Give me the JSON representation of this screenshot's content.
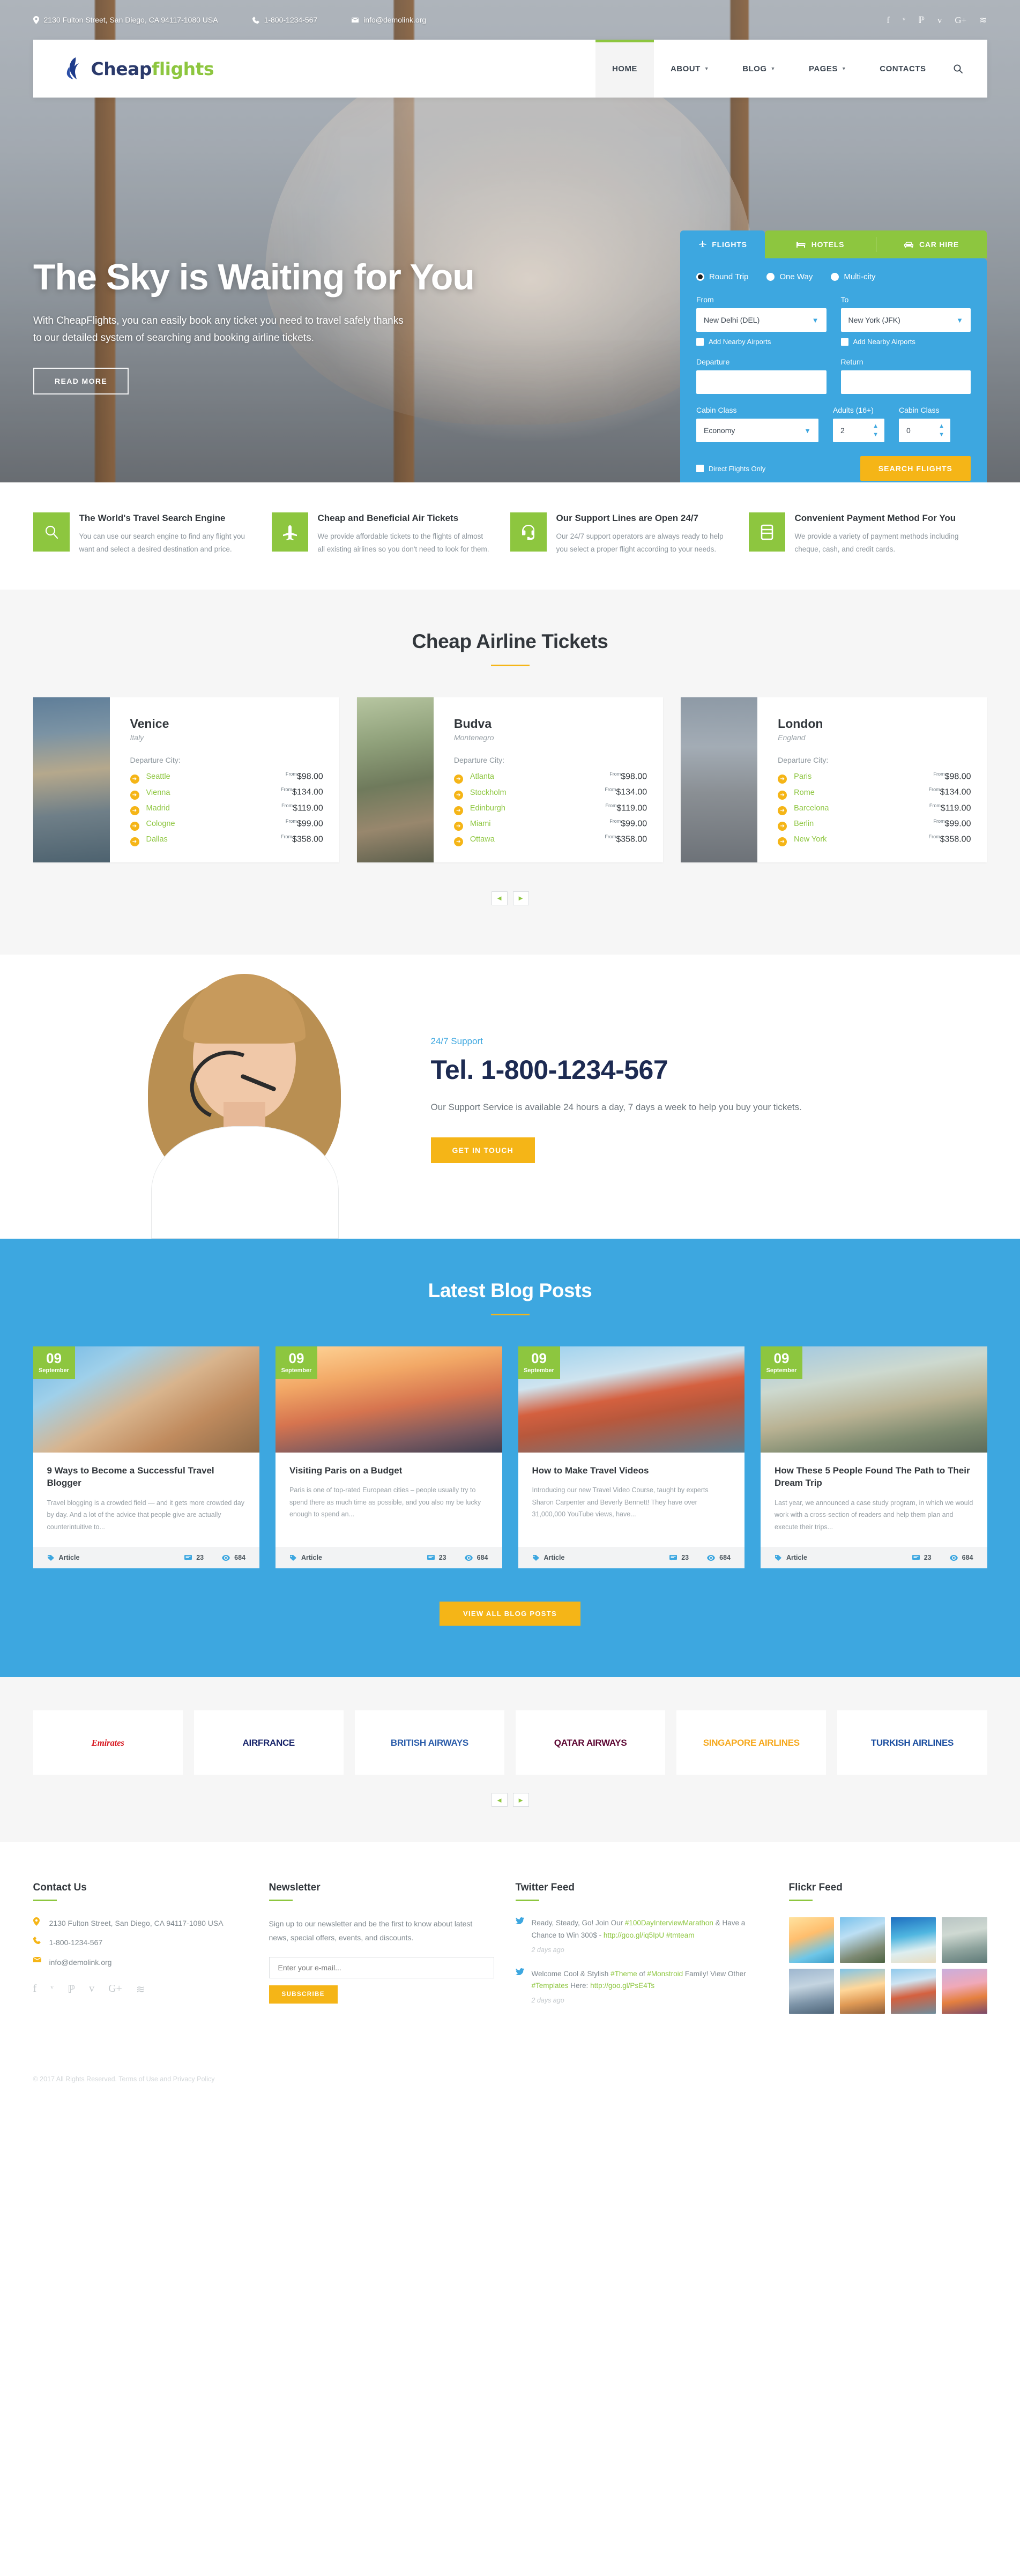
{
  "topbar": {
    "address": "2130 Fulton Street, San Diego, CA 94117-1080 USA",
    "phone": "1-800-1234-567",
    "email": "info@demolink.org",
    "social": [
      {
        "name": "facebook",
        "glyph": "f"
      },
      {
        "name": "twitter",
        "glyph": "ᵛ"
      },
      {
        "name": "pinterest",
        "glyph": "ℙ"
      },
      {
        "name": "vimeo",
        "glyph": "ᴠ"
      },
      {
        "name": "google-plus",
        "glyph": "G+"
      },
      {
        "name": "rss",
        "glyph": "≋"
      }
    ]
  },
  "header": {
    "logo_primary": "Cheap",
    "logo_accent": "flights",
    "nav": [
      {
        "label": "HOME",
        "has_caret": false,
        "active": true
      },
      {
        "label": "ABOUT",
        "has_caret": true,
        "active": false
      },
      {
        "label": "BLOG",
        "has_caret": true,
        "active": false
      },
      {
        "label": "PAGES",
        "has_caret": true,
        "active": false
      },
      {
        "label": "CONTACTS",
        "has_caret": false,
        "active": false
      }
    ],
    "search_icon": "search-icon"
  },
  "hero": {
    "title": "The Sky is Waiting for You",
    "subtitle": "With CheapFlights, you can easily book any ticket you need to travel safely thanks to our detailed system of searching and booking airline tickets.",
    "button": "READ MORE"
  },
  "booking": {
    "tabs": [
      {
        "label": "FLIGHTS",
        "icon": "plane-icon",
        "active": true
      },
      {
        "label": "HOTELS",
        "icon": "bed-icon",
        "active": false
      },
      {
        "label": "CAR HIRE",
        "icon": "car-icon",
        "active": false
      }
    ],
    "trip_types": [
      {
        "label": "Round Trip",
        "selected": true
      },
      {
        "label": "One Way",
        "selected": false
      },
      {
        "label": "Multi-city",
        "selected": false
      }
    ],
    "from_label": "From",
    "from_value": "New Delhi (DEL)",
    "to_label": "To",
    "to_value": "New York (JFK)",
    "nearby_from": "Add Nearby Airports",
    "nearby_to": "Add Nearby Airports",
    "departure_label": "Departure",
    "departure_value": "",
    "return_label": "Return",
    "return_value": "",
    "cabin_label": "Cabin Class",
    "cabin_value": "Economy",
    "adults_label": "Adults (16+)",
    "adults_value": "2",
    "cabin2_label": "Cabin Class",
    "cabin2_value": "0",
    "direct_only": "Direct Flights Only",
    "search_button": "SEARCH FLIGHTS"
  },
  "features": [
    {
      "icon": "search-icon",
      "title": "The World's Travel Search Engine",
      "text": "You can use our search engine to find any flight you want and select a desired destination and price."
    },
    {
      "icon": "plane-icon",
      "title": "Cheap and Beneficial Air Tickets",
      "text": "We provide affordable tickets to the flights of almost all existing airlines so you don't need to look for them."
    },
    {
      "icon": "headset-icon",
      "title": "Our Support Lines are Open 24/7",
      "text": "Our 24/7 support operators are always ready to help you select a proper flight according to your needs."
    },
    {
      "icon": "card-icon",
      "title": "Convenient Payment Method For You",
      "text": "We provide a variety of payment methods including cheque, cash, and credit cards."
    }
  ],
  "tickets": {
    "title": "Cheap Airline Tickets",
    "departure_label": "Departure City:",
    "from_prefix": "From",
    "prev_icon": "chevron-left-icon",
    "next_icon": "chevron-right-icon",
    "cards": [
      {
        "city": "Venice",
        "country": "Italy",
        "photo": "ph-venice",
        "routes": [
          {
            "city": "Seattle",
            "price": "$98.00"
          },
          {
            "city": "Vienna",
            "price": "$134.00"
          },
          {
            "city": "Madrid",
            "price": "$119.00"
          },
          {
            "city": "Cologne",
            "price": "$99.00"
          },
          {
            "city": "Dallas",
            "price": "$358.00"
          }
        ]
      },
      {
        "city": "Budva",
        "country": "Montenegro",
        "photo": "ph-budva",
        "routes": [
          {
            "city": "Atlanta",
            "price": "$98.00"
          },
          {
            "city": "Stockholm",
            "price": "$134.00"
          },
          {
            "city": "Edinburgh",
            "price": "$119.00"
          },
          {
            "city": "Miami",
            "price": "$99.00"
          },
          {
            "city": "Ottawa",
            "price": "$358.00"
          }
        ]
      },
      {
        "city": "London",
        "country": "England",
        "photo": "ph-london",
        "routes": [
          {
            "city": "Paris",
            "price": "$98.00"
          },
          {
            "city": "Rome",
            "price": "$134.00"
          },
          {
            "city": "Barcelona",
            "price": "$119.00"
          },
          {
            "city": "Berlin",
            "price": "$99.00"
          },
          {
            "city": "New York",
            "price": "$358.00"
          }
        ]
      }
    ]
  },
  "support": {
    "kicker": "24/7 Support",
    "tel": "Tel. 1-800-1234-567",
    "desc": "Our Support Service is available 24 hours a day, 7 days a week to help you buy your tickets.",
    "button": "GET IN TOUCH"
  },
  "blog": {
    "title": "Latest Blog Posts",
    "view_all": "VIEW ALL BLOG POSTS",
    "meta_tag": "Article",
    "posts": [
      {
        "day": "09",
        "month": "September",
        "title": "9 Ways to Become a Successful Travel Blogger",
        "excerpt": "Travel blogging is a crowded field — and it gets more crowded day by day. And a lot of the advice that people give are actually counterintuitive to...",
        "comments": "23",
        "views": "684",
        "photo": "pimg1"
      },
      {
        "day": "09",
        "month": "September",
        "title": "Visiting Paris on a Budget",
        "excerpt": "Paris is one of top-rated European cities – people usually try to spend there as much time as possible, and you also my be lucky enough to spend an...",
        "comments": "23",
        "views": "684",
        "photo": "pimg2"
      },
      {
        "day": "09",
        "month": "September",
        "title": "How to Make Travel Videos",
        "excerpt": "Introducing our new Travel Video Course, taught by experts Sharon Carpenter and Beverly Bennett! They have over 31,000,000 YouTube views, have...",
        "comments": "23",
        "views": "684",
        "photo": "pimg3"
      },
      {
        "day": "09",
        "month": "September",
        "title": "How These 5 People Found The Path to Their Dream Trip",
        "excerpt": "Last year, we announced a case study program, in which we would work with a cross-section of readers and help them plan and execute their trips...",
        "comments": "23",
        "views": "684",
        "photo": "pimg4"
      }
    ]
  },
  "partners": {
    "prev_icon": "chevron-left-icon",
    "next_icon": "chevron-right-icon",
    "logos": [
      {
        "name": "Emirates",
        "color": "#d71921"
      },
      {
        "name": "AIRFRANCE",
        "color": "#18256b"
      },
      {
        "name": "BRITISH AIRWAYS",
        "color": "#2a5caa"
      },
      {
        "name": "QATAR AIRWAYS",
        "color": "#5c0632"
      },
      {
        "name": "SINGAPORE AIRLINES",
        "color": "#f6a81c"
      },
      {
        "name": "TURKISH AIRLINES",
        "color": "#1b4ea0"
      }
    ]
  },
  "footer": {
    "contact": {
      "title": "Contact Us",
      "address": "2130 Fulton Street, San Diego, CA 94117-1080 USA",
      "phone": "1-800-1234-567",
      "email": "info@demolink.org",
      "social": [
        {
          "name": "facebook",
          "glyph": "f"
        },
        {
          "name": "twitter",
          "glyph": "ᵛ"
        },
        {
          "name": "pinterest",
          "glyph": "ℙ"
        },
        {
          "name": "vimeo",
          "glyph": "ᴠ"
        },
        {
          "name": "google-plus",
          "glyph": "G+"
        },
        {
          "name": "rss",
          "glyph": "≋"
        }
      ]
    },
    "newsletter": {
      "title": "Newsletter",
      "desc": "Sign up to our newsletter and be the first to know about latest news, special offers, events, and discounts.",
      "placeholder": "Enter your e-mail...",
      "value": "",
      "button": "SUBSCRIBE"
    },
    "twitter": {
      "title": "Twitter Feed",
      "tweets": [
        {
          "p1": "Ready, Steady, Go! Join Our ",
          "tag1": "#100DayInterviewMarathon",
          "p2": " & Have a Chance to Win 300$ - ",
          "link": "http://goo.gl/iq5IpU",
          "p3": "  ",
          "tag2": "#tmteam",
          "ago": "2 days ago"
        },
        {
          "p1": "Welcome Cool & Stylish ",
          "tag1": "#Theme",
          "p2": " of ",
          "tag2": "#Monstroid",
          "p3": " Family! View Other ",
          "tag3": "#Templates",
          "p4": " Here: ",
          "link": "http://goo.gl/PsE4Ts",
          "ago": "2 days ago"
        }
      ]
    },
    "flickr": {
      "title": "Flickr Feed",
      "thumbs": [
        "fl1",
        "fl2",
        "fl3",
        "fl4",
        "fl5",
        "fl6",
        "fl7",
        "fl8"
      ]
    },
    "copyright": "© 2017 All Rights Reserved. Terms of Use and Privacy Policy"
  },
  "colors": {
    "blue": "#3da7e0",
    "green": "#8dc63f",
    "amber": "#f5b517",
    "navy": "#1d2b52",
    "dark": "#32373c"
  }
}
